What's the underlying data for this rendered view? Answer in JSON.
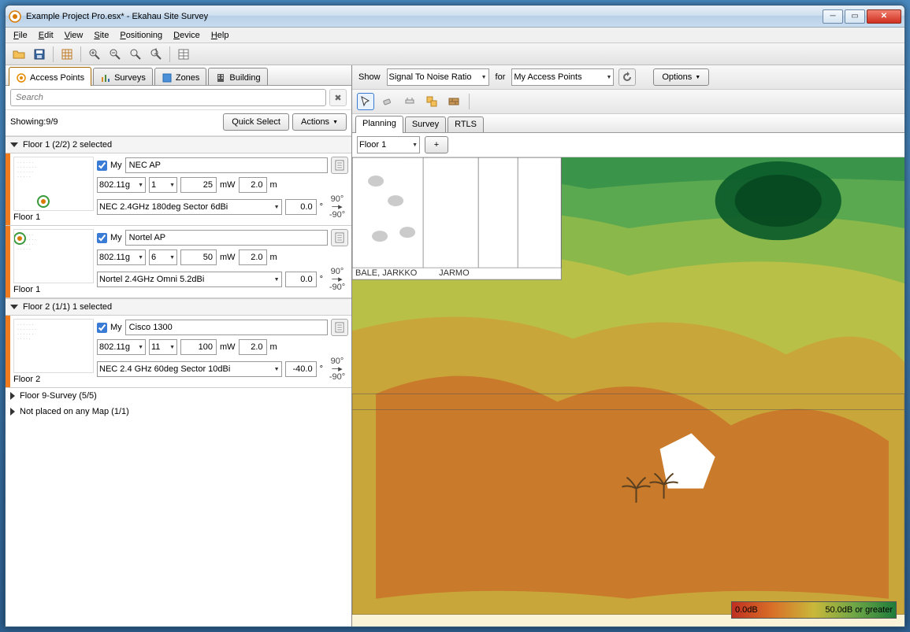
{
  "window": {
    "title": "Example Project Pro.esx* - Ekahau Site Survey"
  },
  "menu": {
    "file": "File",
    "edit": "Edit",
    "view": "View",
    "site": "Site",
    "positioning": "Positioning",
    "device": "Device",
    "help": "Help"
  },
  "left": {
    "tabs": {
      "aps": "Access Points",
      "surveys": "Surveys",
      "zones": "Zones",
      "building": "Building"
    },
    "search_placeholder": "Search",
    "showing": "Showing:9/9",
    "quick_select": "Quick Select",
    "actions": "Actions",
    "groups": {
      "g1": {
        "title": "Floor 1 (2/2) 2 selected"
      },
      "g2": {
        "title": "Floor 2 (1/1) 1 selected"
      },
      "g3": {
        "title": "Floor 9-Survey (5/5)"
      },
      "g4": {
        "title": "Not placed on any Map (1/1)"
      }
    },
    "aps": {
      "ap1": {
        "my": "My",
        "name": "NEC AP",
        "floor": "Floor 1",
        "radio": "802.11g",
        "ch": "1",
        "pwr": "25",
        "pwr_unit": "mW",
        "ht": "2.0",
        "ht_unit": "m",
        "ant": "NEC 2.4GHz 180deg Sector 6dBi",
        "tilt": "0.0",
        "deg": "°",
        "ang_top": "90°",
        "ang_bot": "-90°"
      },
      "ap2": {
        "my": "My",
        "name": "Nortel AP",
        "floor": "Floor 1",
        "radio": "802.11g",
        "ch": "6",
        "pwr": "50",
        "pwr_unit": "mW",
        "ht": "2.0",
        "ht_unit": "m",
        "ant": "Nortel 2.4GHz Omni 5.2dBi",
        "tilt": "0.0",
        "deg": "°",
        "ang_top": "90°",
        "ang_bot": "-90°"
      },
      "ap3": {
        "my": "My",
        "name": "Cisco 1300",
        "floor": "Floor 2",
        "radio": "802.11g",
        "ch": "11",
        "pwr": "100",
        "pwr_unit": "mW",
        "ht": "2.0",
        "ht_unit": "m",
        "ant": "NEC 2.4 GHz 60deg Sector 10dBi",
        "tilt": "-40.0",
        "deg": "°",
        "ang_top": "90°",
        "ang_bot": "-90°"
      }
    }
  },
  "right": {
    "show_lbl": "Show",
    "show_val": "Signal To Noise Ratio",
    "for_lbl": "for",
    "for_val": "My Access Points",
    "options": "Options",
    "tabs": {
      "planning": "Planning",
      "survey": "Survey",
      "rtls": "RTLS"
    },
    "floor": "Floor 1",
    "add": "+",
    "legend": {
      "min": "0.0dB",
      "max": "50.0dB or greater"
    },
    "floorplan_labels": {
      "l1": "BALE, JARKKO",
      "l2": "JARMO"
    }
  }
}
